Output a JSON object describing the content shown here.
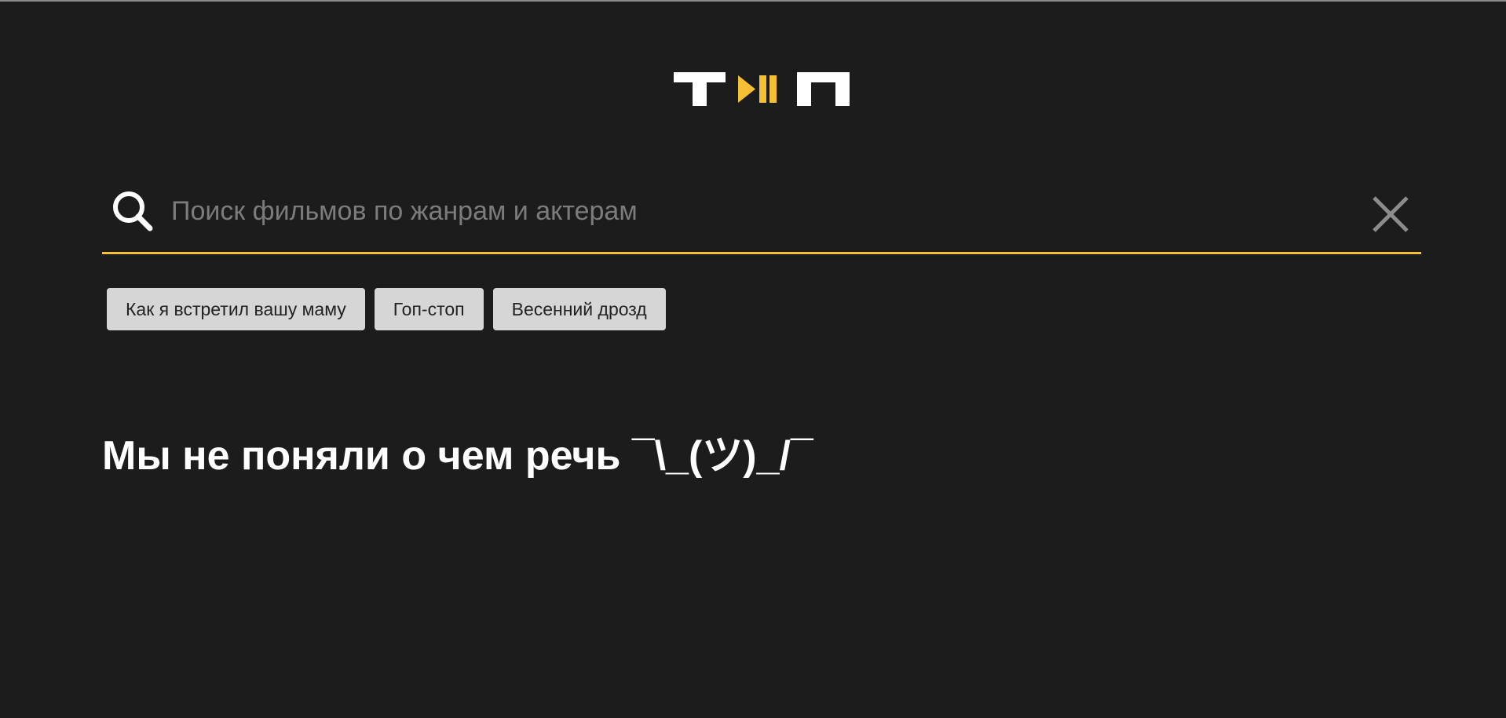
{
  "logo": {
    "name": "logo",
    "colors": {
      "primary": "#ffffff",
      "accent": "#f5c032"
    }
  },
  "search": {
    "icon": "search-icon",
    "placeholder": "Поиск фильмов по жанрам и актерам",
    "value": "",
    "clear_icon": "close-icon",
    "underline_color": "#f5c032"
  },
  "suggestions": [
    {
      "label": "Как я встретил вашу маму"
    },
    {
      "label": "Гоп-стоп"
    },
    {
      "label": "Весенний дрозд"
    }
  ],
  "empty_state": {
    "message": "Мы не поняли о чем речь ¯\\_(ツ)_/¯"
  },
  "theme": {
    "background": "#1c1c1c",
    "chip_background": "#d6d6d6",
    "text": "#ffffff"
  }
}
